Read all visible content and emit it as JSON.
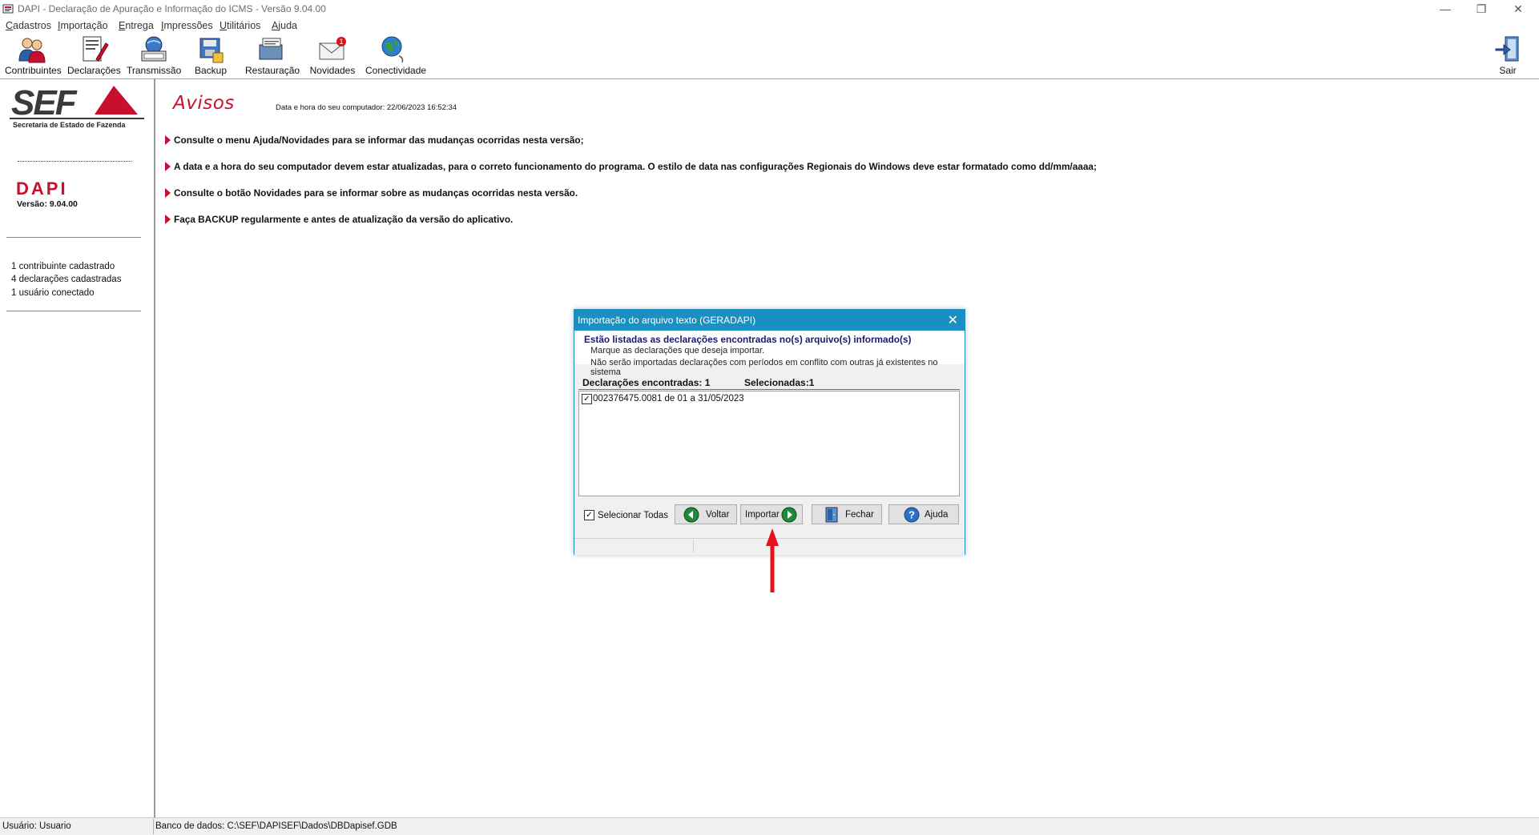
{
  "window": {
    "title": "DAPI - Declaração de Apuração e Informação do ICMS - Versão 9.04.00",
    "minimize_glyph": "—",
    "restore_glyph": "❐",
    "close_glyph": "✕"
  },
  "menu": [
    {
      "label": "Cadastros"
    },
    {
      "label": "Importação"
    },
    {
      "label": "Entrega"
    },
    {
      "label": "Impressões"
    },
    {
      "label": "Utilitários"
    },
    {
      "label": "Ajuda"
    }
  ],
  "toolbar": {
    "items": [
      {
        "label": "Contribuintes",
        "icon": "users-icon"
      },
      {
        "label": "Declarações",
        "icon": "document-icon"
      },
      {
        "label": "Transmissão",
        "icon": "transmission-icon"
      },
      {
        "label": "Backup",
        "icon": "backup-icon"
      },
      {
        "label": "Restauração",
        "icon": "restore-icon"
      },
      {
        "label": "Novidades",
        "icon": "mail-icon",
        "badge": "1"
      },
      {
        "label": "Conectividade",
        "icon": "globe-icon"
      }
    ],
    "exit_label": "Sair"
  },
  "left_panel": {
    "logo_text": "SEF",
    "logo_subtitle": "Secretaria de Estado de Fazenda",
    "app_name": "DAPI",
    "version": "Versão: 9.04.00",
    "stats": [
      "1 contribuinte cadastrado",
      "4 declarações cadastradas",
      "1 usuário conectado"
    ]
  },
  "main": {
    "title": "Avisos",
    "datetime": "Data e hora do seu computador: 22/06/2023 16:52:34",
    "notices": [
      "Consulte o menu Ajuda/Novidades para se informar das mudanças ocorridas nesta versão;",
      "A data e a hora do seu computador devem estar atualizadas, para o correto funcionamento do programa. O estilo de data nas configurações Regionais do Windows deve estar formatado como dd/mm/aaaa;",
      "Consulte o botão Novidades para se informar sobre as mudanças ocorridas nesta versão.",
      "Faça BACKUP regularmente e antes de atualização da versão do aplicativo."
    ]
  },
  "dialog": {
    "title": "Importação do arquivo texto (GERADAPI)",
    "close_glyph": "✕",
    "header_title": "Estão listadas as declarações encontradas no(s) arquivo(s) informado(s)",
    "header_line1": "Marque as declarações que deseja importar.",
    "header_line2": "Não serão importadas declarações com períodos em conflito com outras já existentes no sistema",
    "found_label": "Declarações encontradas: 1",
    "selected_label": "Selecionadas:1",
    "items": [
      {
        "label": "002376475.0081 de 01 a 31/05/2023",
        "checked": true
      }
    ],
    "select_all_label": "Selecionar Todas",
    "select_all_checked": true,
    "check_glyph": "✓",
    "buttons": {
      "back": "Voltar",
      "import": "Importar",
      "close": "Fechar",
      "help": "Ajuda"
    }
  },
  "status": {
    "user": "Usuário: Usuario",
    "database": "Banco de dados: C:\\SEF\\DAPISEF\\Dados\\DBDapisef.GDB"
  },
  "colors": {
    "accent": "#1b8fbf",
    "brand_red": "#c8102e",
    "annotation_red": "#e8101a"
  }
}
